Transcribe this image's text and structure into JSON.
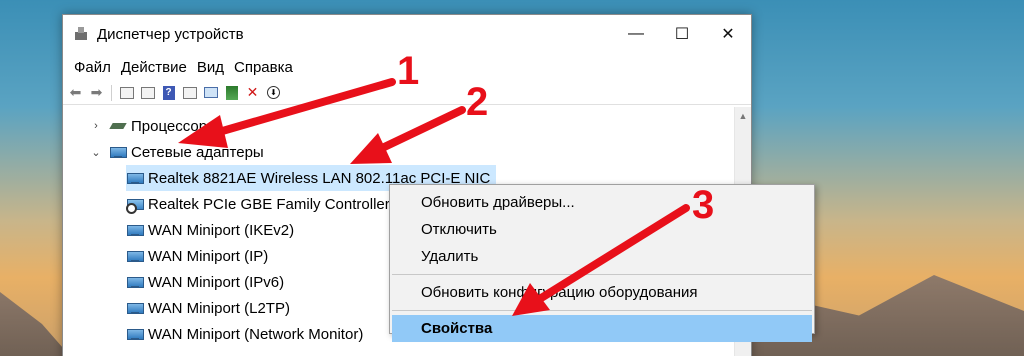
{
  "window": {
    "title": "Диспетчер устройств",
    "controls": {
      "minimize": "—",
      "maximize": "☐",
      "close": "✕"
    }
  },
  "menu": [
    "Файл",
    "Действие",
    "Вид",
    "Справка"
  ],
  "tree": {
    "processors": "Процессоры",
    "network_adapters": "Сетевые адаптеры",
    "devices": [
      "Realtek 8821AE Wireless LAN 802.11ac PCI-E NIC",
      "Realtek PCIe GBE Family Controller",
      "WAN Miniport (IKEv2)",
      "WAN Miniport (IP)",
      "WAN Miniport (IPv6)",
      "WAN Miniport (L2TP)",
      "WAN Miniport (Network Monitor)"
    ]
  },
  "context_menu": {
    "update_drivers": "Обновить драйверы...",
    "disable": "Отключить",
    "uninstall": "Удалить",
    "scan_hardware": "Обновить конфигурацию оборудования",
    "properties": "Свойства"
  },
  "annotations": {
    "n1": "1",
    "n2": "2",
    "n3": "3",
    "arrow_color": "#e8101a"
  },
  "colors": {
    "selection": "#cce8ff",
    "menu_highlight": "#91c9f7"
  }
}
